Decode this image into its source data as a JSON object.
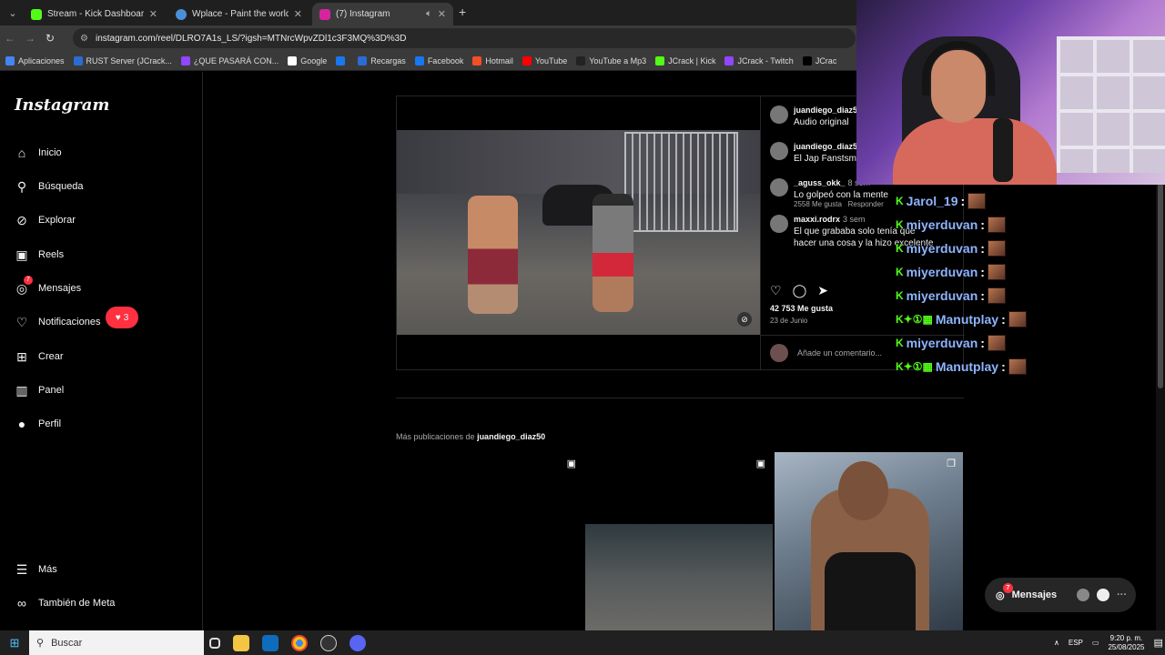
{
  "browser": {
    "tabs": [
      {
        "title": "Stream - Kick Dashboard",
        "color": "#53fc18"
      },
      {
        "title": "Wplace - Paint the world",
        "color": "#4a90d9"
      },
      {
        "title": "(7) Instagram",
        "color": "#d6249f"
      }
    ],
    "url": "instagram.com/reel/DLRO7A1s_LS/?igsh=MTNrcWpvZDl1c3F3MQ%3D%3D",
    "bookmarks": [
      {
        "label": "Aplicaciones",
        "color": "#4285f4"
      },
      {
        "label": "RUST Server (JCrack...",
        "color": "#2b6cd4"
      },
      {
        "label": "¿QUE PASARÁ CON...",
        "color": "#9146ff"
      },
      {
        "label": "Google",
        "color": "#ffffff"
      },
      {
        "label": "",
        "color": "#1877f2"
      },
      {
        "label": "Recargas",
        "color": "#2b6cd4"
      },
      {
        "label": "Facebook",
        "color": "#1877f2"
      },
      {
        "label": "Hotmail",
        "color": "#f25022"
      },
      {
        "label": "YouTube",
        "color": "#ff0000"
      },
      {
        "label": "YouTube a Mp3",
        "color": "#222222"
      },
      {
        "label": "JCrack | Kick",
        "color": "#53fc18"
      },
      {
        "label": "JCrack - Twitch",
        "color": "#9146ff"
      },
      {
        "label": "JCrac",
        "color": "#000000"
      }
    ]
  },
  "instagram": {
    "logo": "Instagram",
    "nav": [
      {
        "label": "Inicio",
        "icon": "home-icon",
        "glyph": "⌂"
      },
      {
        "label": "Búsqueda",
        "icon": "search-icon",
        "glyph": "⚲"
      },
      {
        "label": "Explorar",
        "icon": "compass-icon",
        "glyph": "⊘"
      },
      {
        "label": "Reels",
        "icon": "reels-icon",
        "glyph": "▣"
      },
      {
        "label": "Mensajes",
        "icon": "messenger-icon",
        "glyph": "◎"
      },
      {
        "label": "Notificaciones",
        "icon": "heart-icon",
        "glyph": "♡"
      },
      {
        "label": "Crear",
        "icon": "plus-square-icon",
        "glyph": "⊞"
      },
      {
        "label": "Panel",
        "icon": "chart-icon",
        "glyph": "▥"
      },
      {
        "label": "Perfil",
        "icon": "avatar",
        "glyph": "●"
      }
    ],
    "messages_badge": "7",
    "notifications_badge": "3",
    "more": "Más",
    "meta": "También de Meta",
    "post": {
      "comments": [
        {
          "user": "juandiego_diaz5",
          "ago": "",
          "text": "Audio original",
          "meta": ""
        },
        {
          "user": "juandiego_diaz5",
          "ago": "",
          "text": "El Jap Fanstsma",
          "meta": ""
        },
        {
          "user": "_aguss_okk_",
          "ago": "8 sem",
          "text": "Lo golpeó con la mente",
          "meta": "2558 Me gusta   Responder"
        },
        {
          "user": "maxxi.rodrx",
          "ago": "3 sem",
          "text": "El que grababa solo tenía que hacer una cosa y la hizo excelente",
          "meta": ""
        }
      ],
      "likes": "42 753 Me gusta",
      "date": "23 de Junio",
      "add_comment": "Añade un comentario..."
    },
    "more_posts_prefix": "Más publicaciones de ",
    "more_posts_user": "juandiego_diaz50",
    "messages_button": "Mensajes",
    "messages_button_badge": "7"
  },
  "chat": [
    {
      "user": "Jarol_19",
      "badges": "K"
    },
    {
      "user": "miyerduvan",
      "badges": "K"
    },
    {
      "user": "miyerduvan",
      "badges": "K"
    },
    {
      "user": "miyerduvan",
      "badges": "K"
    },
    {
      "user": "miyerduvan",
      "badges": "K"
    },
    {
      "user": "Manutplay",
      "badges": "K✦①▦"
    },
    {
      "user": "miyerduvan",
      "badges": "K"
    },
    {
      "user": "Manutplay",
      "badges": "K✦①▦"
    }
  ],
  "taskbar": {
    "search": "Buscar",
    "lang": "ESP",
    "time": "9:20 p. m.",
    "date": "25/08/2025"
  }
}
